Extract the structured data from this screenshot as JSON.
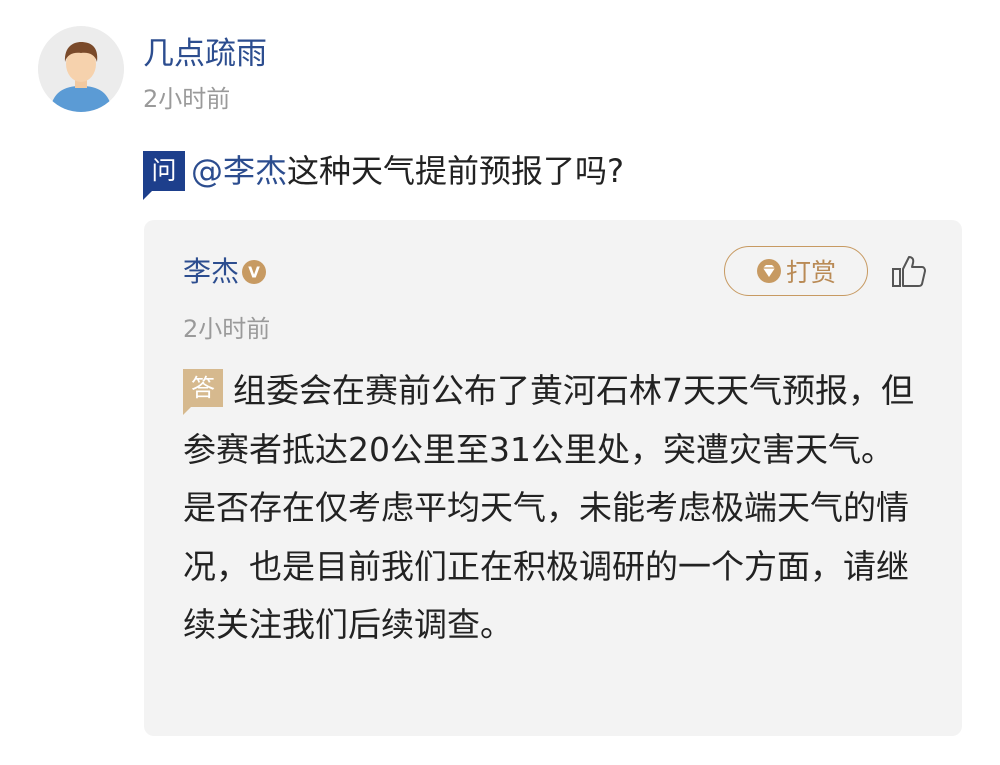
{
  "question": {
    "user_name": "几点疏雨",
    "time": "2小时前",
    "badge": "问",
    "mention": "@李杰",
    "text": "这种天气提前预报了吗?"
  },
  "answer": {
    "author_name": "李杰",
    "verified_badge_letter": "V",
    "tip_label": "打赏",
    "time": "2小时前",
    "badge": "答",
    "text": "组委会在赛前公布了黄河石林7天天气预报，但参赛者抵达20公里至31公里处，突遭灾害天气。是否存在仅考虑平均天气，未能考虑极端天气的情况，也是目前我们正在积极调研的一个方面，请继续关注我们后续调查。"
  },
  "icons": {
    "avatar": "user-avatar",
    "verified": "verified-v-icon",
    "tip": "gem-icon",
    "like": "thumbs-up-icon"
  },
  "colors": {
    "link_blue": "#2c4d8f",
    "question_badge": "#1d3f8c",
    "answer_badge": "#d6b98e",
    "tip_gold": "#c79a62",
    "card_bg": "#f3f3f3",
    "muted": "#9a9a9a"
  }
}
